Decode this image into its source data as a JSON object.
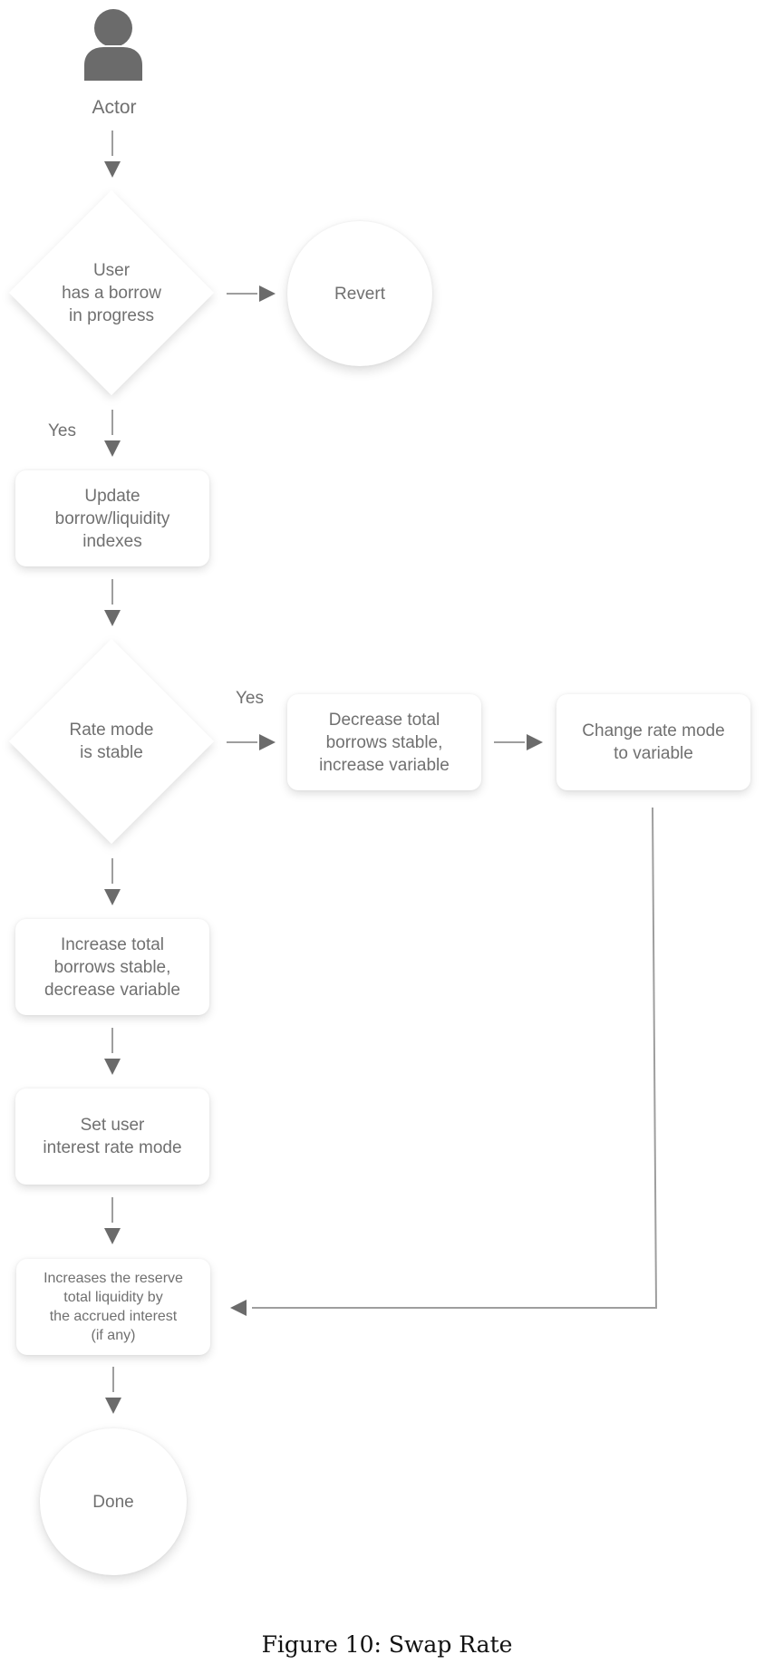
{
  "diagram": {
    "actor": {
      "label": "Actor",
      "icon": "user-icon"
    },
    "nodes": {
      "decision_borrow": {
        "type": "decision",
        "label": "User\nhas a borrow\nin progress"
      },
      "revert": {
        "type": "terminal",
        "label": "Revert"
      },
      "update_indexes": {
        "type": "process",
        "label": "Update\nborrow/liquidity\nindexes"
      },
      "decision_rate_mode": {
        "type": "decision",
        "label": "Rate mode\nis stable"
      },
      "decrease_stable": {
        "type": "process",
        "label": "Decrease total\nborrows stable,\nincrease variable"
      },
      "change_to_variable": {
        "type": "process",
        "label": "Change rate mode\nto variable"
      },
      "increase_stable": {
        "type": "process",
        "label": "Increase total\nborrows stable,\ndecrease variable"
      },
      "set_rate_mode": {
        "type": "process",
        "label": "Set user\ninterest rate mode"
      },
      "increase_liquidity": {
        "type": "process",
        "label": "Increases the reserve\ntotal liquidity by\nthe accrued interest\n(if any)"
      },
      "done": {
        "type": "terminal",
        "label": "Done"
      }
    },
    "edges": [
      {
        "from": "actor",
        "to": "decision_borrow",
        "label": ""
      },
      {
        "from": "decision_borrow",
        "to": "revert",
        "label": ""
      },
      {
        "from": "decision_borrow",
        "to": "update_indexes",
        "label": "Yes"
      },
      {
        "from": "update_indexes",
        "to": "decision_rate_mode",
        "label": ""
      },
      {
        "from": "decision_rate_mode",
        "to": "decrease_stable",
        "label": "Yes"
      },
      {
        "from": "decrease_stable",
        "to": "change_to_variable",
        "label": ""
      },
      {
        "from": "decision_rate_mode",
        "to": "increase_stable",
        "label": ""
      },
      {
        "from": "increase_stable",
        "to": "set_rate_mode",
        "label": ""
      },
      {
        "from": "set_rate_mode",
        "to": "increase_liquidity",
        "label": ""
      },
      {
        "from": "change_to_variable",
        "to": "increase_liquidity",
        "label": ""
      },
      {
        "from": "increase_liquidity",
        "to": "done",
        "label": ""
      }
    ],
    "edge_labels": {
      "yes_down": "Yes",
      "yes_right": "Yes"
    },
    "colors": {
      "shape_fill": "#ffffff",
      "text": "#707070",
      "arrow": "#6b6b6b",
      "line": "#9e9e9e"
    }
  },
  "caption": "Figure 10: Swap Rate"
}
